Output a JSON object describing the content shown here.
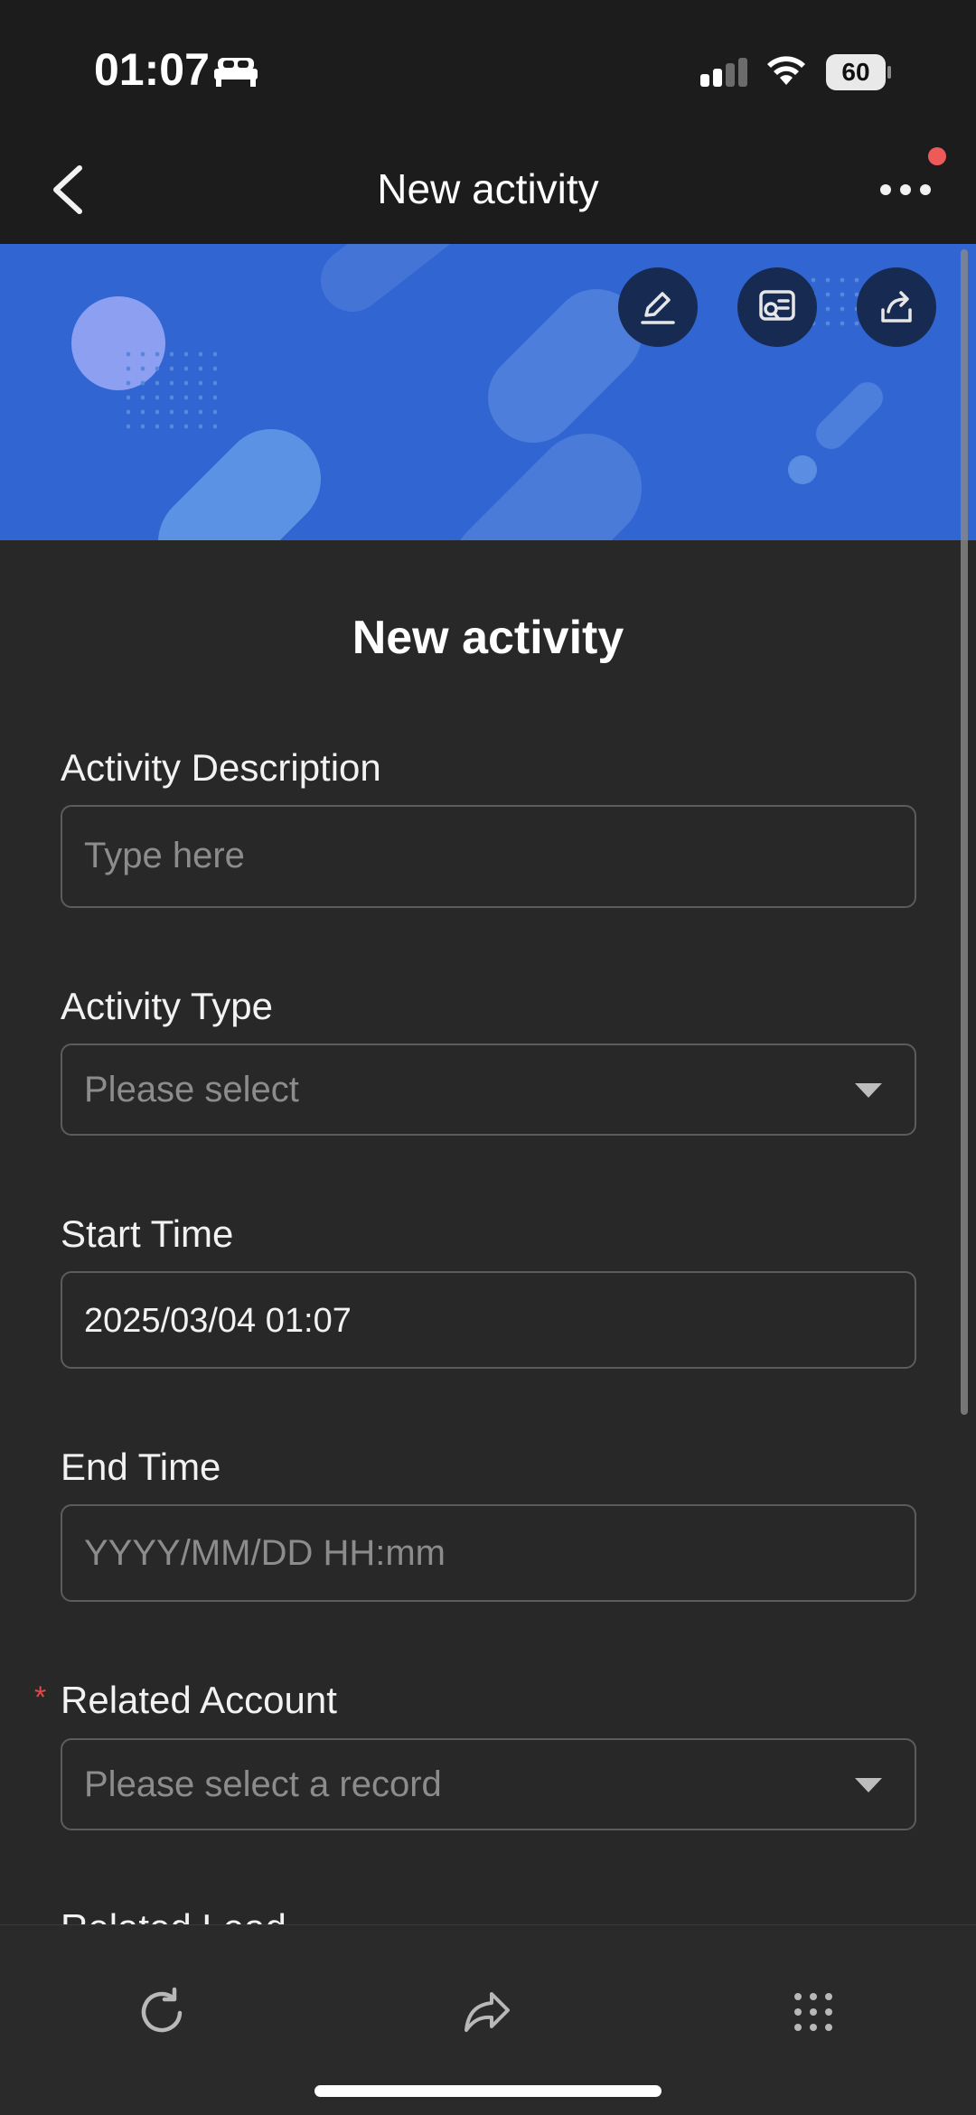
{
  "status_bar": {
    "time": "01:07",
    "battery": "60"
  },
  "nav": {
    "title": "New activity",
    "notification_color": "#ee5a5a"
  },
  "banner": {
    "background": "#3065d2",
    "actions": [
      {
        "name": "edit-icon"
      },
      {
        "name": "search-document-icon"
      },
      {
        "name": "share-icon"
      }
    ]
  },
  "form": {
    "title": "New activity",
    "fields": [
      {
        "label": "Activity Description",
        "placeholder": "Type here",
        "value": "",
        "type": "text",
        "required": false
      },
      {
        "label": "Activity Type",
        "placeholder": "Please select",
        "value": "",
        "type": "select",
        "required": false
      },
      {
        "label": "Start Time",
        "placeholder": "",
        "value": "2025/03/04 01:07",
        "type": "datetime",
        "required": false
      },
      {
        "label": "End Time",
        "placeholder": "YYYY/MM/DD HH:mm",
        "value": "",
        "type": "datetime",
        "required": false
      },
      {
        "label": "Related Account",
        "placeholder": "Please select a record",
        "value": "",
        "type": "select",
        "required": true,
        "required_mark": "*"
      },
      {
        "label": "Related Lead"
      }
    ]
  },
  "toolbar": {
    "items": [
      {
        "name": "refresh-icon"
      },
      {
        "name": "forward-icon"
      },
      {
        "name": "grid-menu-icon"
      }
    ]
  }
}
